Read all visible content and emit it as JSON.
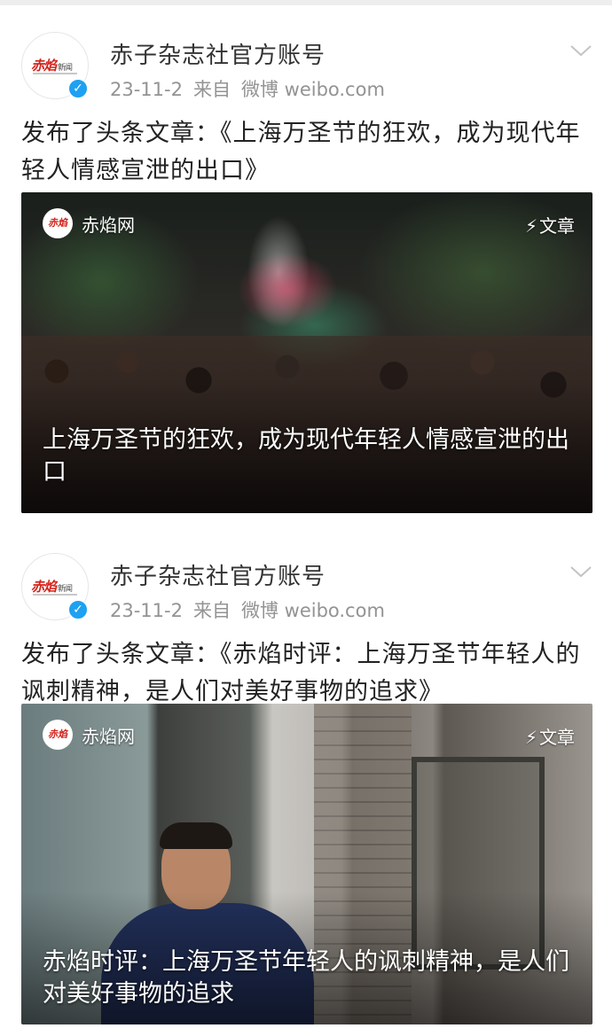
{
  "posts": [
    {
      "account_name": "赤子杂志社官方账号",
      "avatar_logo": "赤焰",
      "avatar_logo_sub": "新闻",
      "date": "23-11-2",
      "source_prefix": "来自",
      "source_app": "微博 weibo.com",
      "text": "发布了头条文章：《上海万圣节的狂欢，成为现代年轻人情感宣泄的出口》",
      "card": {
        "source_icon": "赤焰",
        "source_name": "赤焰网",
        "type_label": "文章",
        "title": "上海万圣节的狂欢，成为现代年轻人情感宣泄的出口"
      }
    },
    {
      "account_name": "赤子杂志社官方账号",
      "avatar_logo": "赤焰",
      "avatar_logo_sub": "新闻",
      "date": "23-11-2",
      "source_prefix": "来自",
      "source_app": "微博 weibo.com",
      "text": "发布了头条文章：《赤焰时评：上海万圣节年轻人的讽刺精神，是人们对美好事物的追求》",
      "card": {
        "source_icon": "赤焰",
        "source_name": "赤焰网",
        "type_label": "文章",
        "title": "赤焰时评：上海万圣节年轻人的讽刺精神，是人们对美好事物的追求"
      }
    }
  ],
  "icons": {
    "verified": "verified-icon",
    "chevron": "chevron-down-icon",
    "bolt": "lightning-icon"
  },
  "colors": {
    "verified_blue": "#1da1f2",
    "brand_red": "#d2231b",
    "meta_gray": "#939393"
  }
}
